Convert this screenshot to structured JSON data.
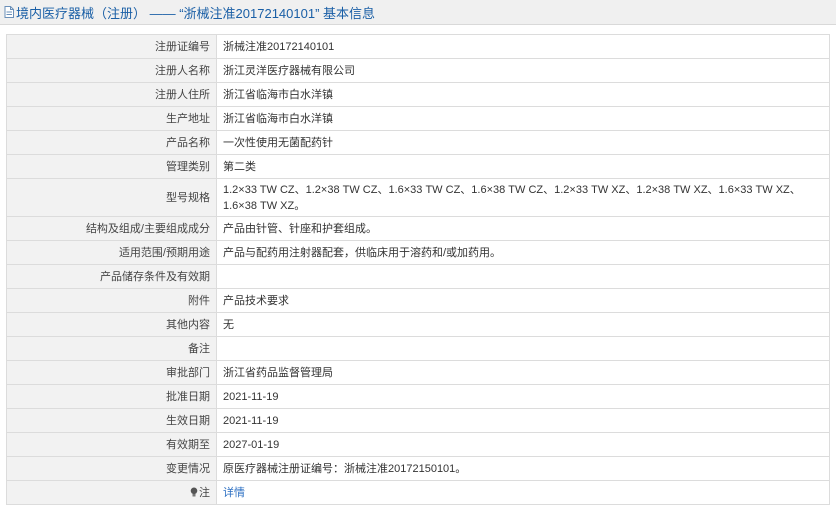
{
  "header": {
    "title": "境内医疗器械（注册） —— “浙械注准20172140101” 基本信息",
    "icon": "document-icon"
  },
  "rows": [
    {
      "label": "注册证编号",
      "value": "浙械注准20172140101"
    },
    {
      "label": "注册人名称",
      "value": "浙江灵洋医疗器械有限公司"
    },
    {
      "label": "注册人住所",
      "value": "浙江省临海市白水洋镇"
    },
    {
      "label": "生产地址",
      "value": "浙江省临海市白水洋镇"
    },
    {
      "label": "产品名称",
      "value": "一次性使用无菌配药针"
    },
    {
      "label": "管理类别",
      "value": "第二类"
    },
    {
      "label": "型号规格",
      "value": "1.2×33 TW CZ、1.2×38 TW CZ、1.6×33 TW CZ、1.6×38 TW CZ、1.2×33 TW XZ、1.2×38 TW XZ、1.6×33 TW XZ、1.6×38 TW XZ。"
    },
    {
      "label": "结构及组成/主要组成成分",
      "value": "产品由针管、针座和护套组成。"
    },
    {
      "label": "适用范围/预期用途",
      "value": "产品与配药用注射器配套，供临床用于溶药和/或加药用。"
    },
    {
      "label": "产品储存条件及有效期",
      "value": ""
    },
    {
      "label": "附件",
      "value": "产品技术要求"
    },
    {
      "label": "其他内容",
      "value": "无"
    },
    {
      "label": "备注",
      "value": ""
    },
    {
      "label": "审批部门",
      "value": "浙江省药品监督管理局"
    },
    {
      "label": "批准日期",
      "value": "2021-11-19"
    },
    {
      "label": "生效日期",
      "value": "2021-11-19"
    },
    {
      "label": "有效期至",
      "value": "2027-01-19"
    },
    {
      "label": "变更情况",
      "value": "原医疗器械注册证编号：浙械注准20172150101。"
    },
    {
      "label": "注",
      "value": "详情",
      "icon": "bulb-icon"
    }
  ],
  "colors": {
    "title": "#1a5fa6",
    "link": "#2a6ec2",
    "label_bg": "#f2f2f2",
    "border": "#dcdcdc"
  }
}
